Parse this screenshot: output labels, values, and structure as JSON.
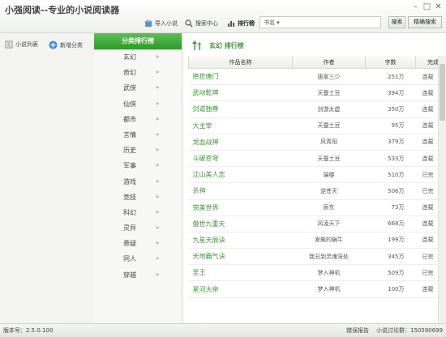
{
  "app": {
    "title": "小强阅读--专业的小说阅读器"
  },
  "toolbar": {
    "import_label": "导入小说",
    "search_center_label": "搜索中心",
    "ranking_label": "排行榜",
    "search_type": "书名",
    "search_button": "搜索",
    "precise_search_button": "精确搜索"
  },
  "sidebar": {
    "novel_list_label": "小说列表",
    "add_category_label": "新增分类"
  },
  "categories": {
    "header": "分类排行榜",
    "items": [
      "玄幻",
      "奇幻",
      "武侠",
      "仙侠",
      "都市",
      "言情",
      "历史",
      "军事",
      "游戏",
      "竞技",
      "科幻",
      "灵异",
      "悬疑",
      "同人",
      "穿越"
    ],
    "arrow": "»"
  },
  "ranking": {
    "title": "玄幻 排行榜",
    "columns": [
      "作品名称",
      "作者",
      "字数",
      "完成状"
    ],
    "rows": [
      {
        "name": "绝世唐门",
        "author": "唐家三少",
        "words": "251万",
        "status": "连载"
      },
      {
        "name": "武动乾坤",
        "author": "天蚕土豆",
        "words": "394万",
        "status": "连载"
      },
      {
        "name": "剑道独尊",
        "author": "剑游太虚",
        "words": "350万",
        "status": "连载"
      },
      {
        "name": "大主宰",
        "author": "天蚕土豆",
        "words": "95万",
        "status": "连载"
      },
      {
        "name": "龙血战神",
        "author": "风青阳",
        "words": "379万",
        "status": "连载"
      },
      {
        "name": "斗破苍穹",
        "author": "天蚕土豆",
        "words": "533万",
        "status": "连载"
      },
      {
        "name": "江山美人志",
        "author": "端楼",
        "words": "510万",
        "status": "已完"
      },
      {
        "name": "杀神",
        "author": "逆苍天",
        "words": "506万",
        "status": "已完"
      },
      {
        "name": "完美世界",
        "author": "辰东",
        "words": "73万",
        "status": "连载"
      },
      {
        "name": "傲世九重天",
        "author": "风凌天下",
        "words": "668万",
        "status": "连载"
      },
      {
        "name": "九星天辰诀",
        "author": "发飙的蜗牛",
        "words": "199万",
        "status": "连载"
      },
      {
        "name": "天地霸气诀",
        "author": "我丑到灵魂深处",
        "words": "345万",
        "status": "已完"
      },
      {
        "name": "圣王",
        "author": "梦入神机",
        "words": "509万",
        "status": "已完"
      },
      {
        "name": "星河大帝",
        "author": "梦入神机",
        "words": "100万",
        "status": "连载"
      }
    ]
  },
  "status": {
    "version": "版本号：2.5.0.100",
    "report": "错误报告",
    "qq_group": "小说讨论群：150590699"
  },
  "colors": {
    "accent_green": "#3a9a34",
    "header_green": "#2f9a2b"
  }
}
